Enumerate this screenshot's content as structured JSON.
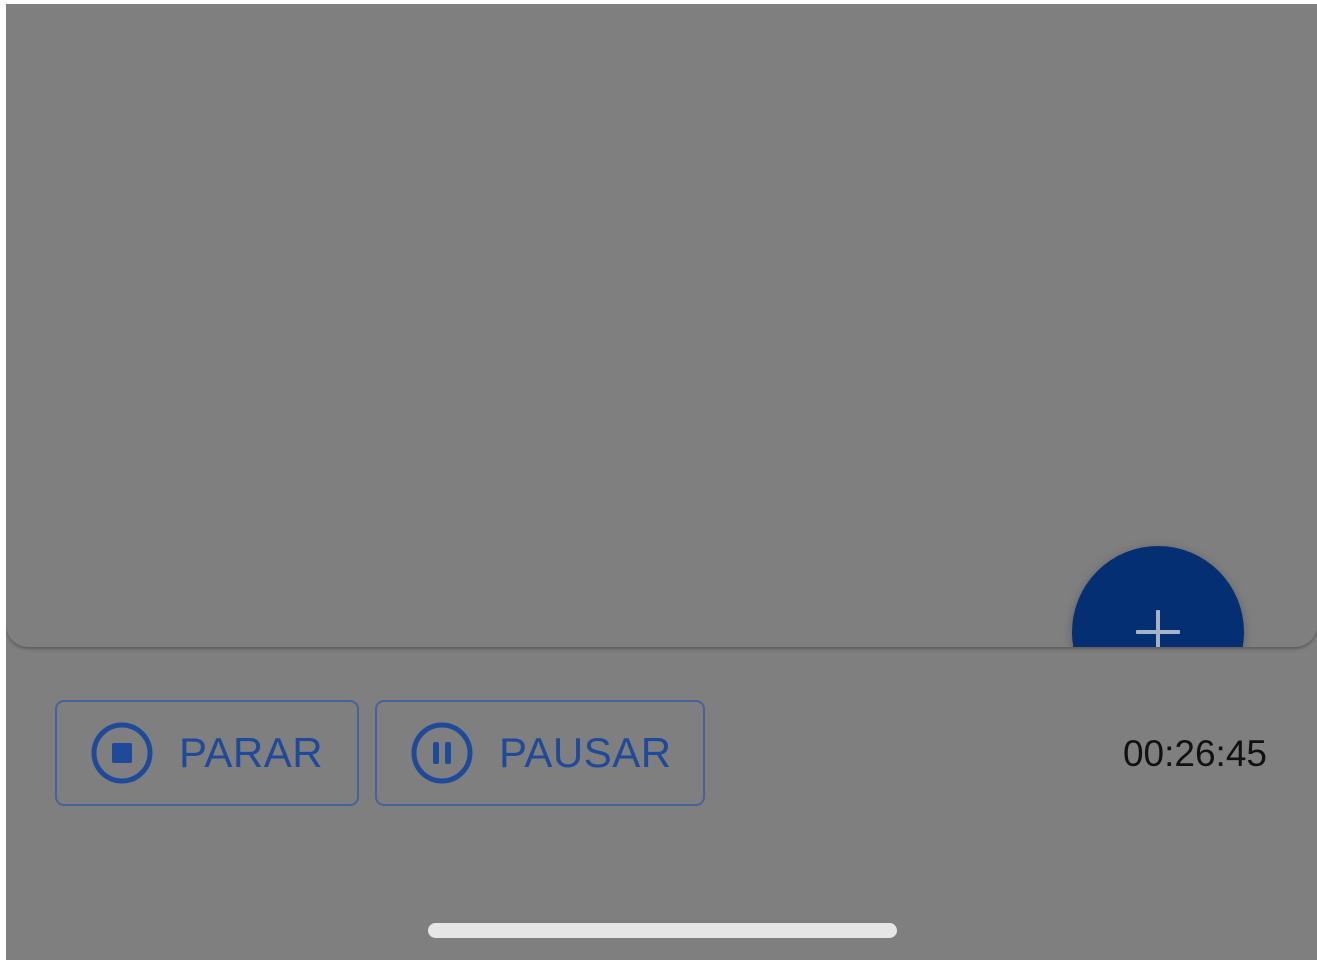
{
  "controls": {
    "stop_label": "PARAR",
    "pause_label": "PAUSAR",
    "elapsed_time": "00:26:45"
  },
  "icons": {
    "fab": "plus-icon",
    "stop": "stop-circle-icon",
    "pause": "pause-circle-icon"
  },
  "colors": {
    "overlay": "#7f7f7f",
    "fab": "#052f73",
    "button_text": "#1f4a9a",
    "button_border": "#47629a",
    "timer_text": "#111111",
    "home_indicator": "#e6e6e6"
  }
}
